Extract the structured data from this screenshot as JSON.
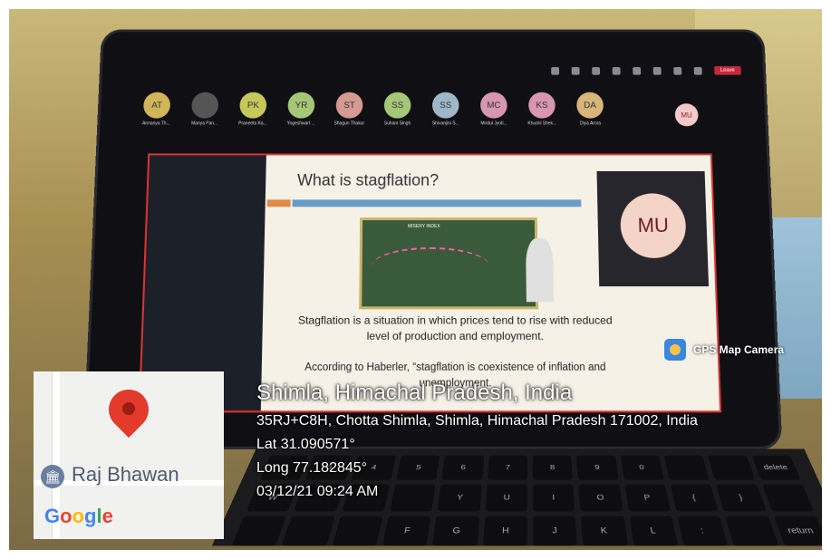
{
  "zoom": {
    "leave_label": "Leave",
    "participants": [
      {
        "initials": "AT",
        "name": "Annanya Th...",
        "color": "#d1b55b"
      },
      {
        "initials": "",
        "name": "Manya Pan...",
        "color": "#555555"
      },
      {
        "initials": "PK",
        "name": "Praneeta Ka...",
        "color": "#c6c85c"
      },
      {
        "initials": "YR",
        "name": "Yogeshwari ...",
        "color": "#a7c778"
      },
      {
        "initials": "ST",
        "name": "Shagun Thakur",
        "color": "#d79a92"
      },
      {
        "initials": "SS",
        "name": "Suhani Singh",
        "color": "#a7c778"
      },
      {
        "initials": "SS",
        "name": "Shivanjini S...",
        "color": "#9fb7c9"
      },
      {
        "initials": "MC",
        "name": "Mridul Jyoti...",
        "color": "#d896b0"
      },
      {
        "initials": "KS",
        "name": "Khushi Shek...",
        "color": "#d896b0"
      },
      {
        "initials": "DA",
        "name": "Diya Arora",
        "color": "#d8b57a"
      }
    ],
    "self_initials": "MU"
  },
  "slide": {
    "title": "What is stagflation?",
    "cartoon_label": "MISERY INDEX",
    "text1": "Stagflation is a situation in which prices tend to rise with reduced level of production and employment.",
    "text2": "According to Haberler, “stagflation is coexistence of inflation and unemployment."
  },
  "speaker_initials": "MU",
  "gps": {
    "app_label": "GPS Map Camera",
    "city": "Shimla, Himachal Pradesh, India",
    "address": "35RJ+C8H, Chotta Shimla, Shimla, Himachal Pradesh 171002, India",
    "lat": "Lat 31.090571°",
    "long": "Long 77.182845°",
    "datetime": "03/12/21 09:24 AM"
  },
  "map": {
    "place": "Raj Bhawan",
    "brand": "Google",
    "brand_colors": [
      "#4285F4",
      "#EA4335",
      "#FBBC05",
      "#4285F4",
      "#34A853",
      "#EA4335"
    ]
  },
  "keyboard": {
    "keys": [
      "",
      "3",
      "4",
      "5",
      "6",
      "7",
      "8",
      "9",
      "0",
      "",
      "",
      "delete",
      "W",
      "",
      "",
      "",
      "Y",
      "U",
      "I",
      "O",
      "P",
      "{",
      "}",
      "",
      "",
      "",
      "",
      "F",
      "G",
      "H",
      "J",
      "K",
      "L",
      ":",
      "",
      "return"
    ]
  }
}
